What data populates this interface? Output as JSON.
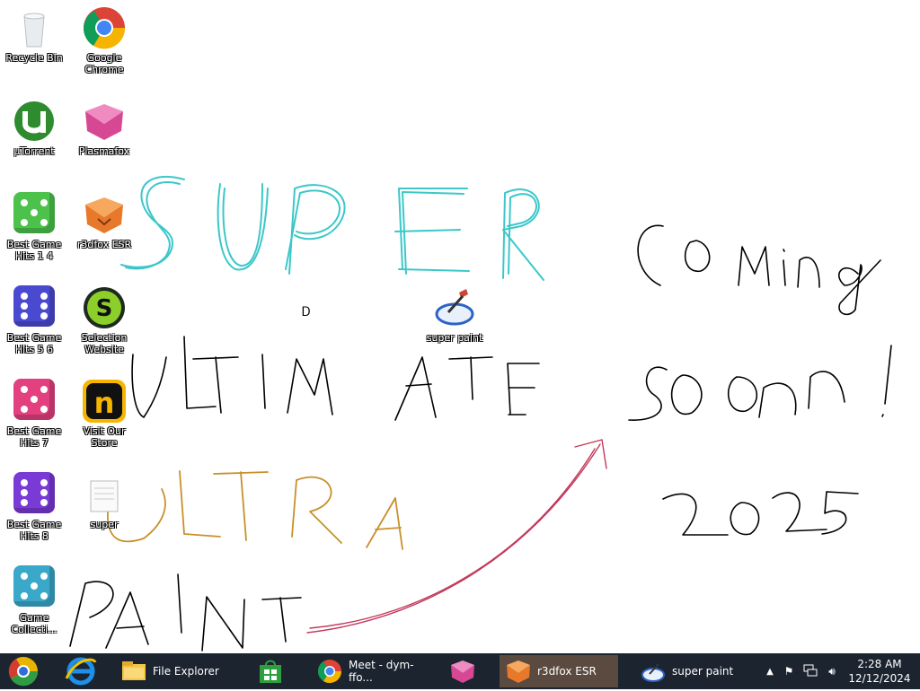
{
  "desktop": {
    "icons": [
      {
        "label": "Recycle Bin",
        "icon": "recycle-bin-icon"
      },
      {
        "label": "Google Chrome",
        "icon": "chrome-icon"
      },
      {
        "label": "µTorrent",
        "icon": "utorrent-icon"
      },
      {
        "label": "Plasmafox",
        "icon": "plasmafox-icon"
      },
      {
        "label": "Best Game Hits 1 4",
        "icon": "dice-icon"
      },
      {
        "label": "r3dfox ESR",
        "icon": "r3dfox-icon"
      },
      {
        "label": "Best Game Hits 5 6",
        "icon": "dice-icon"
      },
      {
        "label": "Selection Website",
        "icon": "selection-icon"
      },
      {
        "label": "Best Game Hits 7",
        "icon": "dice-icon"
      },
      {
        "label": "Visit Our Store",
        "icon": "store-icon"
      },
      {
        "label": "Best Game Hits 8",
        "icon": "dice-icon"
      },
      {
        "label": "super",
        "icon": "document-icon"
      },
      {
        "label": "Game Collecti...",
        "icon": "dice-icon"
      },
      {
        "label": "super paint",
        "icon": "super-paint-icon"
      }
    ],
    "drawing_words": [
      "SUPER",
      "ULTIMATE",
      "ULTRA",
      "PAINT",
      "Coming",
      "soon!",
      "2025"
    ],
    "colors": {
      "super": "#3cc7c9",
      "ultimate": "#000000",
      "ultra": "#c8902c",
      "paint": "#000000",
      "arrow": "#c23a5c"
    }
  },
  "taskbar": {
    "start_icon": "start-orb-icon",
    "pinned": [
      {
        "icon": "internet-explorer-icon"
      }
    ],
    "buttons": [
      {
        "label": "File Explorer",
        "icon": "folder-icon"
      },
      {
        "label": "",
        "icon": "store-bag-icon"
      },
      {
        "label": "Meet - dym-ffo...",
        "icon": "chrome-icon"
      },
      {
        "label": "",
        "icon": "plasmafox-icon"
      },
      {
        "label": "r3dfox ESR",
        "icon": "r3dfox-icon"
      },
      {
        "label": "super paint",
        "icon": "super-paint-icon"
      }
    ],
    "tray": {
      "time": "2:28 AM",
      "date": "12/12/2024",
      "icons": [
        "show-hidden-icon",
        "flag-icon",
        "network-icon",
        "volume-icon"
      ]
    }
  }
}
